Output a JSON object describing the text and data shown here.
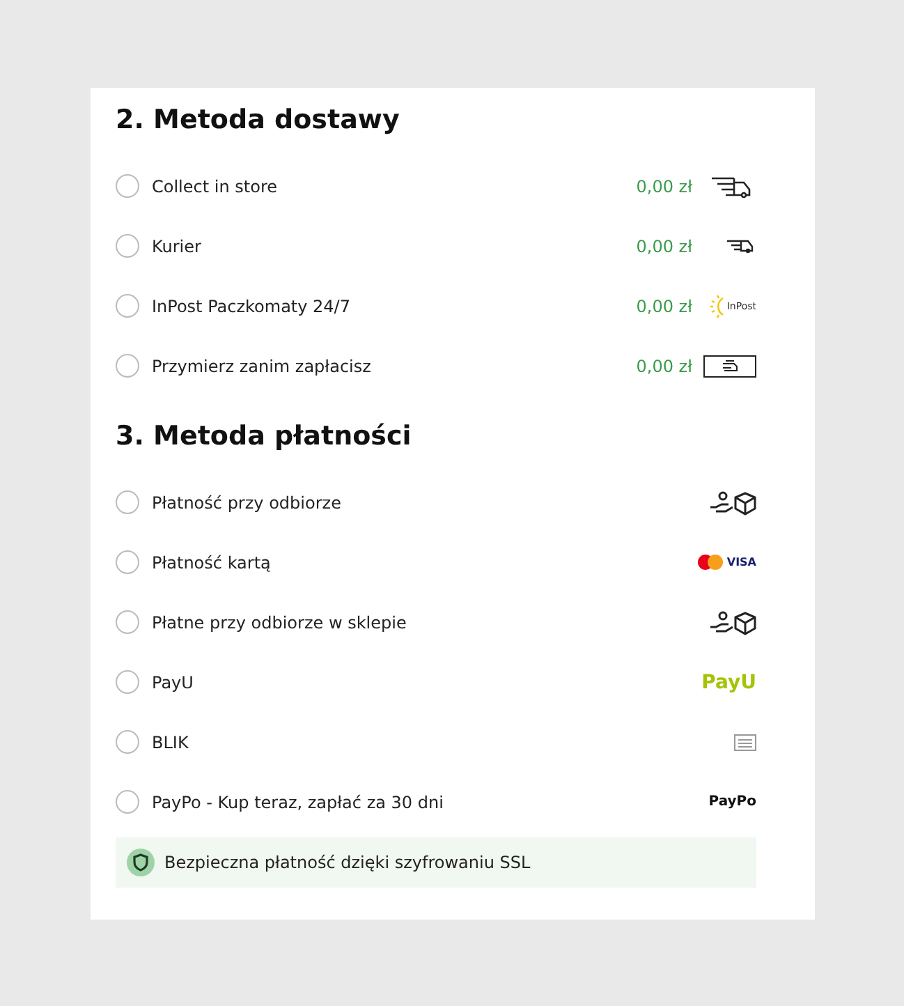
{
  "delivery": {
    "title": "2. Metoda dostawy",
    "options": [
      {
        "label": "Collect in store",
        "price": "0,00 zł",
        "icon": {
          "kind": "truck-large"
        },
        "selected": false
      },
      {
        "label": "Kurier",
        "price": "0,00 zł",
        "icon": {
          "kind": "truck-small"
        },
        "selected": false
      },
      {
        "label": "InPost Paczkomaty 24/7",
        "price": "0,00 zł",
        "icon": {
          "kind": "inpost",
          "logo_text": "InPost"
        },
        "selected": false
      },
      {
        "label": "Przymierz zanim zapłacisz",
        "price": "0,00 zł",
        "icon": {
          "kind": "framed-hand"
        },
        "selected": false
      }
    ]
  },
  "payment": {
    "title": "3. Metoda płatności",
    "options": [
      {
        "label": "Płatność przy odbiorze",
        "icon": {
          "kind": "hand-box"
        },
        "selected": false
      },
      {
        "label": "Płatność kartą",
        "icon": {
          "kind": "cards",
          "logo_text": "VISA"
        },
        "selected": false
      },
      {
        "label": "Płatne przy odbiorze w sklepie",
        "icon": {
          "kind": "hand-box"
        },
        "selected": false
      },
      {
        "label": "PayU",
        "icon": {
          "kind": "payu",
          "logo_text": "PayU"
        },
        "selected": false
      },
      {
        "label": "BLIK",
        "icon": {
          "kind": "keypad"
        },
        "selected": false
      },
      {
        "label": "PayPo - Kup teraz, zapłać za 30 dni",
        "icon": {
          "kind": "paypo",
          "logo_text": "PayPo"
        },
        "selected": false
      }
    ]
  },
  "security_note": "Bezpieczna płatność dzięki szyfrowaniu SSL"
}
